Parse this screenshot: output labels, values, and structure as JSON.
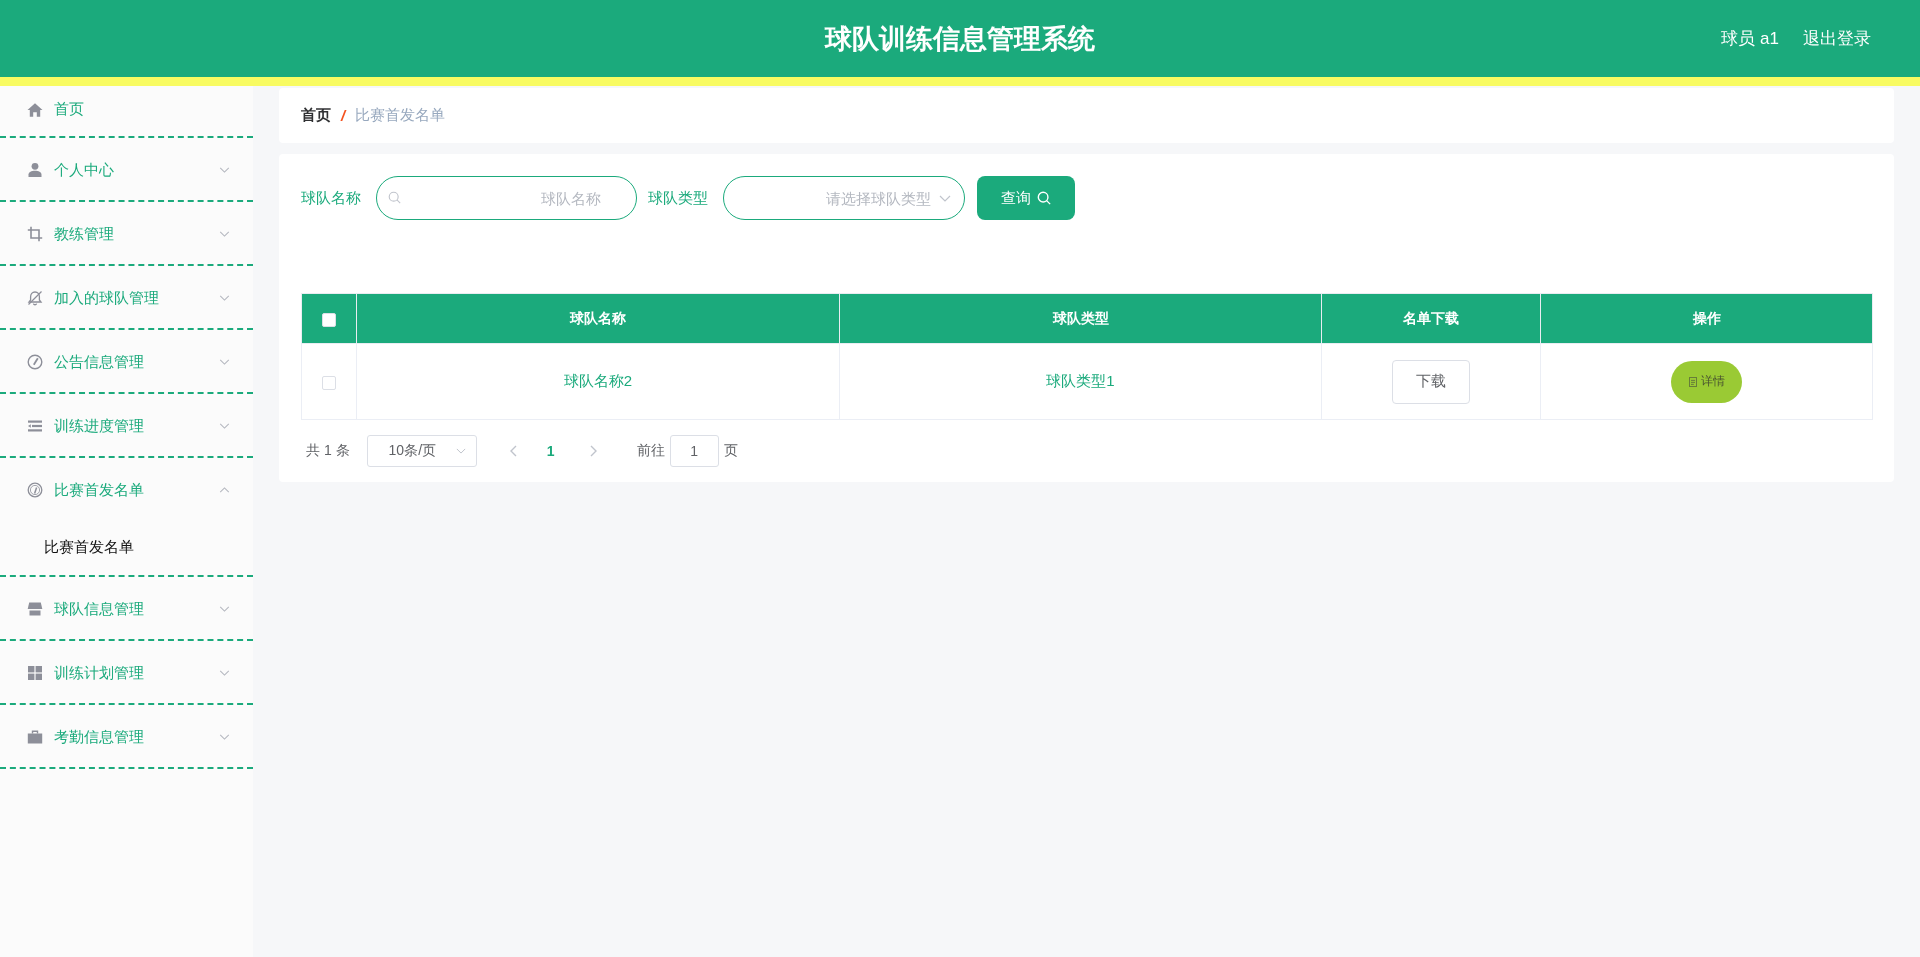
{
  "header": {
    "title": "球队训练信息管理系统",
    "user": "球员 a1",
    "logout": "退出登录"
  },
  "sidebar": {
    "home": {
      "label": "首页"
    },
    "menus": [
      {
        "label": "个人中心",
        "expanded": false
      },
      {
        "label": "教练管理",
        "expanded": false
      },
      {
        "label": "加入的球队管理",
        "expanded": false
      },
      {
        "label": "公告信息管理",
        "expanded": false
      },
      {
        "label": "训练进度管理",
        "expanded": false
      },
      {
        "label": "比赛首发名单",
        "expanded": true,
        "children": [
          {
            "label": "比赛首发名单",
            "selected": true
          }
        ]
      },
      {
        "label": "球队信息管理",
        "expanded": false
      },
      {
        "label": "训练计划管理",
        "expanded": false
      },
      {
        "label": "考勤信息管理",
        "expanded": false
      }
    ]
  },
  "breadcrumb": {
    "items": [
      "首页",
      "比赛首发名单"
    ],
    "separator": "/"
  },
  "search": {
    "fields": [
      {
        "kind": "input",
        "label": "球队名称",
        "placeholder": "球队名称"
      },
      {
        "kind": "select",
        "label": "球队类型",
        "placeholder": "请选择球队类型"
      }
    ],
    "button": "查询"
  },
  "table": {
    "select_all": {
      "checked": false
    },
    "columns": [
      "球队名称",
      "球队类型",
      "名单下载",
      "操作"
    ],
    "rows": [
      {
        "checked": false,
        "cells": [
          "球队名称2",
          "球队类型1"
        ],
        "download": "下载",
        "action": "详情"
      }
    ]
  },
  "pagination": {
    "total": "共 1 条",
    "page_size": "10条/页",
    "pages": [
      {
        "label": "1",
        "selected": true
      }
    ],
    "goto_label": "前往",
    "goto_value": "1",
    "page_suffix": "页"
  }
}
